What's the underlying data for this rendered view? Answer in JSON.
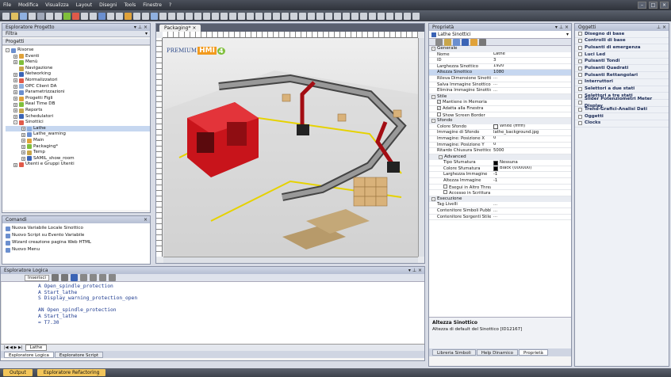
{
  "menu": [
    "File",
    "Modifica",
    "Visualizza",
    "Layout",
    "Disegni",
    "Tools",
    "Finestre",
    "?"
  ],
  "project_explorer": {
    "title": "Esploratore Progetto",
    "filter_label": "Filtra",
    "projects_label": "Progetti",
    "tree": [
      {
        "label": "Risorse",
        "level": 0,
        "exp": "-"
      },
      {
        "label": "Eventi",
        "level": 1,
        "exp": "+"
      },
      {
        "label": "Menù",
        "level": 1,
        "exp": "+"
      },
      {
        "label": "Navigazione",
        "level": 1,
        "exp": ""
      },
      {
        "label": "Networking",
        "level": 1,
        "exp": "+"
      },
      {
        "label": "Normalizzatori",
        "level": 1,
        "exp": "+"
      },
      {
        "label": "OPC Client DA",
        "level": 1,
        "exp": "+"
      },
      {
        "label": "Parametrizzazioni",
        "level": 1,
        "exp": "+"
      },
      {
        "label": "Progetti Figli",
        "level": 1,
        "exp": "+"
      },
      {
        "label": "Real Time DB",
        "level": 1,
        "exp": "+"
      },
      {
        "label": "Reports",
        "level": 1,
        "exp": "+"
      },
      {
        "label": "Schedulatori",
        "level": 1,
        "exp": "+"
      },
      {
        "label": "Sinottici",
        "level": 1,
        "exp": "-"
      },
      {
        "label": "Lathe",
        "level": 2,
        "exp": "+",
        "selected": true
      },
      {
        "label": "Lathe_warning",
        "level": 2,
        "exp": "+"
      },
      {
        "label": "Main",
        "level": 2,
        "exp": "+"
      },
      {
        "label": "Packaging*",
        "level": 2,
        "exp": "+"
      },
      {
        "label": "Temp",
        "level": 2,
        "exp": "+"
      },
      {
        "label": "SAMIL_show_room",
        "level": 2,
        "exp": "+"
      },
      {
        "label": "Utenti e Gruppi Utenti",
        "level": 1,
        "exp": "+"
      }
    ]
  },
  "commands": {
    "title": "Comandi",
    "items": [
      "Nuova Variabile Locale Sinottico",
      "Nuovo Script su Evento Variabile",
      "Wizard creazione pagina Web HTML",
      "Nuovo Menu"
    ]
  },
  "designer": {
    "tab_label": "Packaging*",
    "logo_text_a": "PREMIUM",
    "logo_text_b": "HMI",
    "logo_num": "4"
  },
  "logic_explorer": {
    "title": "Esploratore Logica",
    "toolbar_label": "Inserisci",
    "code": [
      "A Open_spindle_protection",
      "A Start_lathe",
      "S Display_warning_protection_open",
      "",
      "AN Open_spindle_protection",
      "A Start_lathe",
      "= T7.30"
    ],
    "sheet_tab": "Lathe",
    "bottom_tabs": [
      "Esploratore Logica",
      "Esploratore Script"
    ]
  },
  "properties": {
    "title": "Proprietà",
    "selector_value": "Lathe Sinottici",
    "groups": [
      {
        "name": "Generale",
        "rows": [
          {
            "n": "Nome",
            "v": "Lathe"
          },
          {
            "n": "ID",
            "v": "3"
          },
          {
            "n": "Larghezza Sinottico",
            "v": "1920"
          },
          {
            "n": "Altezza Sinottico",
            "v": "1080",
            "selected": true
          },
          {
            "n": "Rileva Dimensione Sinottico",
            "v": "..."
          },
          {
            "n": "Salva Immagine Sinottico",
            "v": "..."
          },
          {
            "n": "Elimina Immagine Sinottico",
            "v": "..."
          }
        ]
      },
      {
        "name": "Stile",
        "rows": [
          {
            "n": "Mantiene in Memoria",
            "v": "",
            "check": true,
            "checked": true
          },
          {
            "n": "Adatta alla Finestra",
            "v": "",
            "check": true,
            "checked": true
          },
          {
            "n": "Show Screen Border",
            "v": "",
            "check": true,
            "checked": false
          }
        ]
      },
      {
        "name": "Sfondo",
        "rows": [
          {
            "n": "Colore Sfondo",
            "v": "White (ffffff)",
            "swatch": "#ffffff"
          },
          {
            "n": "Immagine di Sfondo",
            "v": "lathe_background.jpg"
          },
          {
            "n": "Immagine: Posizione X",
            "v": "0"
          },
          {
            "n": "Immagine: Posizione Y",
            "v": "0"
          },
          {
            "n": "Ritardo Chiusura Sinottico",
            "v": "5000"
          }
        ]
      },
      {
        "name": "Advanced",
        "sub": true,
        "rows": [
          {
            "n": "Tipo Sfumatura",
            "v": "Nessuna",
            "swatch": "#000000"
          },
          {
            "n": "Colore Sfumatura",
            "v": "Black (000000)",
            "swatch": "#000000"
          },
          {
            "n": "Larghezza Immagine",
            "v": "-1"
          },
          {
            "n": "Altezza Immagine",
            "v": "-1"
          },
          {
            "n": "Esegui in Altro Thread",
            "v": "",
            "check": true,
            "checked": false
          },
          {
            "n": "Accesso in Scrittura",
            "v": "",
            "check": true,
            "checked": false
          }
        ]
      },
      {
        "name": "Esecuzione",
        "rows": [
          {
            "n": "Tag Livelli",
            "v": "..."
          },
          {
            "n": "Contenitore Simboli Pubblici",
            "v": "..."
          },
          {
            "n": "Contenitore Sorgenti Stile",
            "v": "..."
          }
        ]
      }
    ],
    "help_title": "Altezza Sinottico",
    "help_text": "Altezza di default del Sinottico [ID12167]",
    "bottom_tabs": [
      "Libreria Simboli",
      "Help Dinamico",
      "Proprietà"
    ]
  },
  "objects": {
    "title": "Oggetti",
    "items": [
      "Disegno di base",
      "Controlli di base",
      "Pulsanti di emergenza",
      "Luci Led",
      "Pulsanti Tondi",
      "Pulsanti Quadrati",
      "Pulsanti Rettangolari",
      "Interruttori",
      "Selettori a due stati",
      "Selettori a tre stati",
      "Slider Potenziometri Meter Display",
      "Trend-Grafici-Analisi Dati",
      "Oggetti",
      "Clocks"
    ]
  },
  "status": {
    "tabs": [
      "Output",
      "Esploratore Refactoring"
    ]
  }
}
